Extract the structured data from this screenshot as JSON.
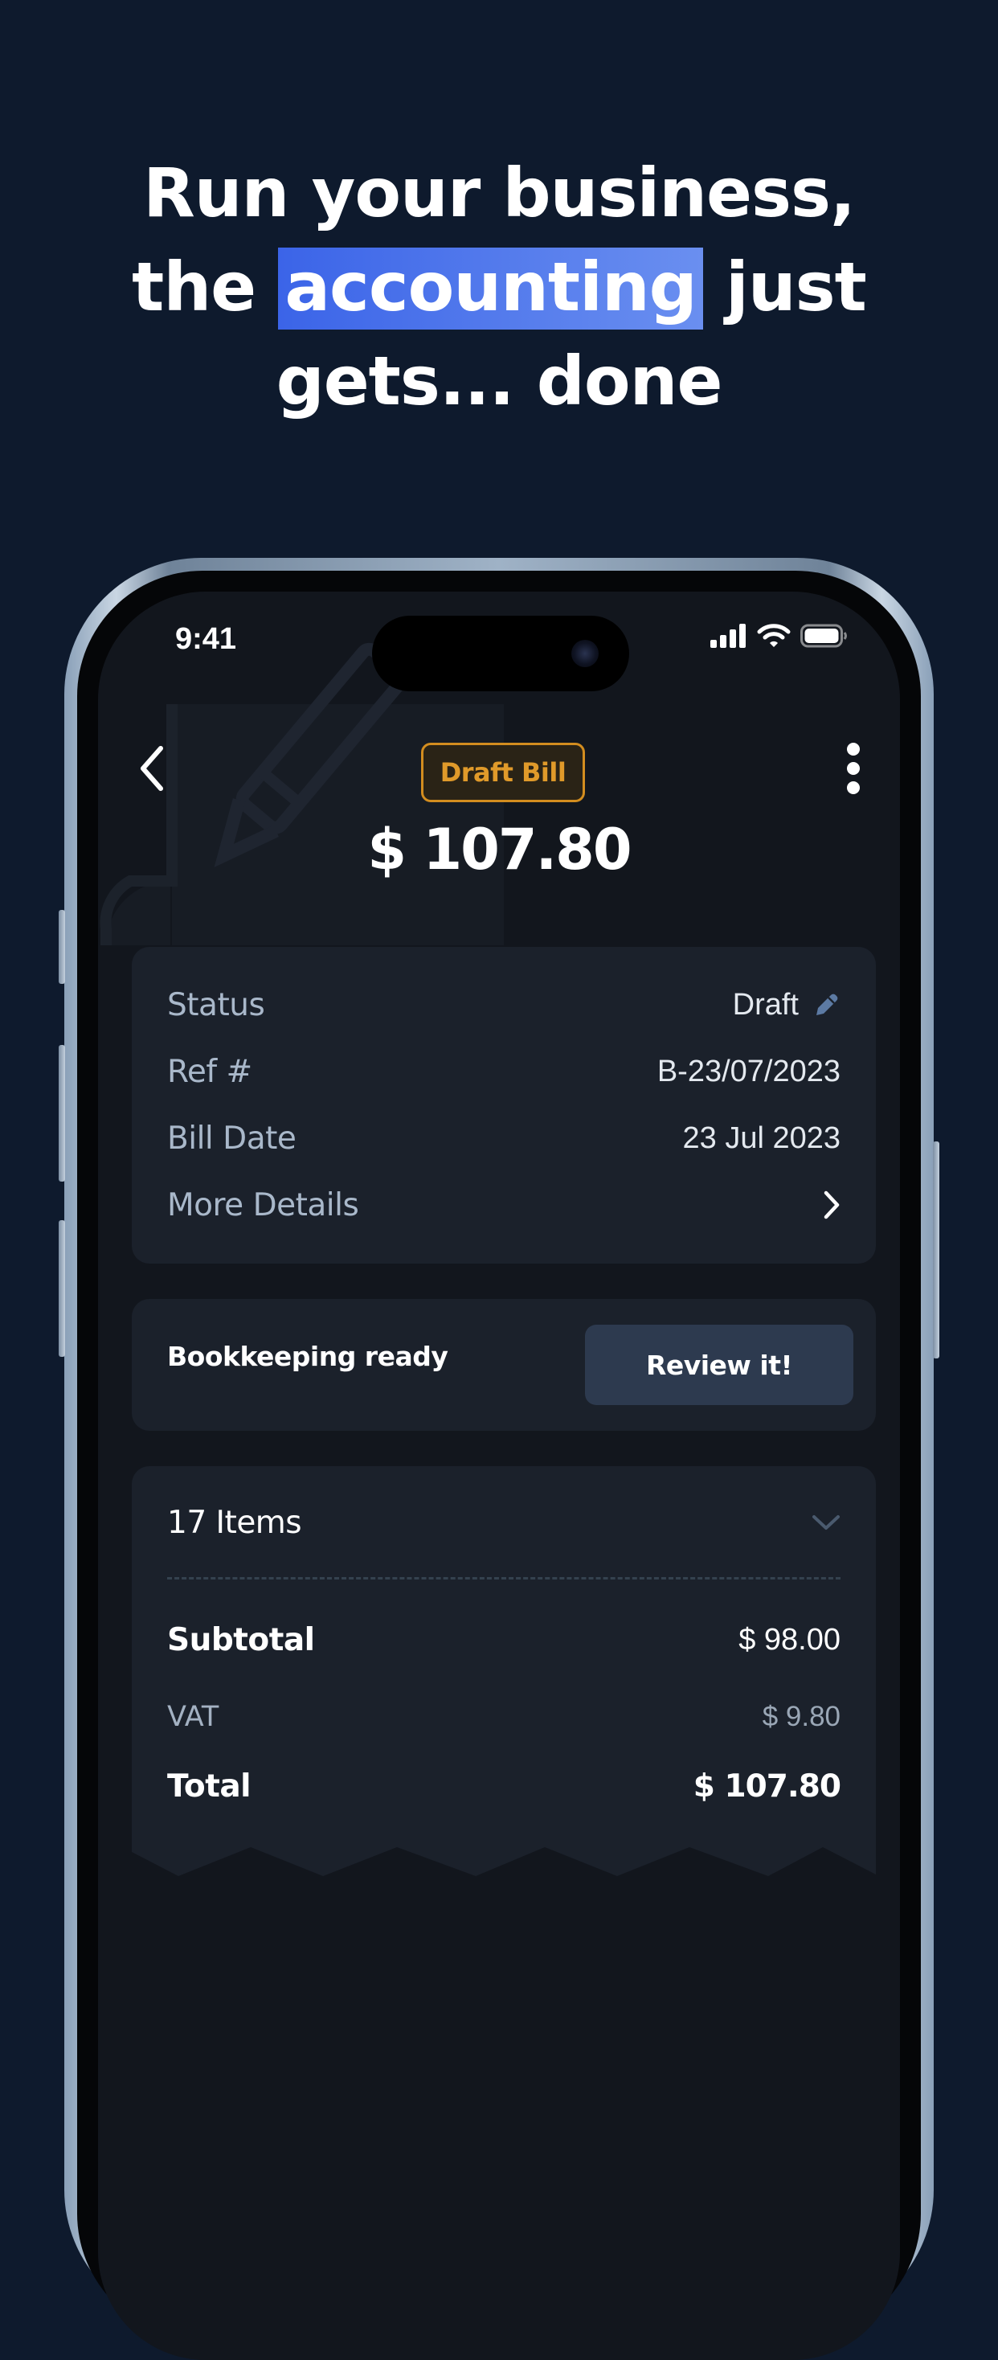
{
  "headline": {
    "line1": "Run your business,",
    "line2_before": "the ",
    "line2_highlight": "accounting",
    "line2_after": " just",
    "line3": "gets... done"
  },
  "status_bar": {
    "time": "9:41"
  },
  "bill": {
    "badge": "Draft Bill",
    "amount": "$ 107.80"
  },
  "details": [
    {
      "label": "Status",
      "value": "Draft"
    },
    {
      "label": "Ref #",
      "value": "B-23/07/2023"
    },
    {
      "label": "Bill Date",
      "value": "23 Jul 2023"
    },
    {
      "label": "More Details",
      "value": ""
    }
  ],
  "bookkeeping": {
    "label": "Bookkeeping ready",
    "button": "Review it!"
  },
  "items": {
    "count_label": "17 Items"
  },
  "summary": {
    "subtotal_label": "Subtotal",
    "subtotal_value": "$ 98.00",
    "vat_label": "VAT",
    "vat_value": "$ 9.80",
    "total_label": "Total",
    "total_value": "$ 107.80"
  },
  "colors": {
    "page_bg": "#0e1a2d",
    "highlight": "#4a72ec",
    "badge_accent": "#e09a2a",
    "card_bg": "#1b212b",
    "button_bg": "#2d3a4f"
  },
  "icons": [
    "chevron-left-icon",
    "more-vertical-icon",
    "pencil-icon",
    "chevron-right-icon",
    "chevron-down-icon",
    "signal-icon",
    "wifi-icon",
    "battery-icon"
  ]
}
